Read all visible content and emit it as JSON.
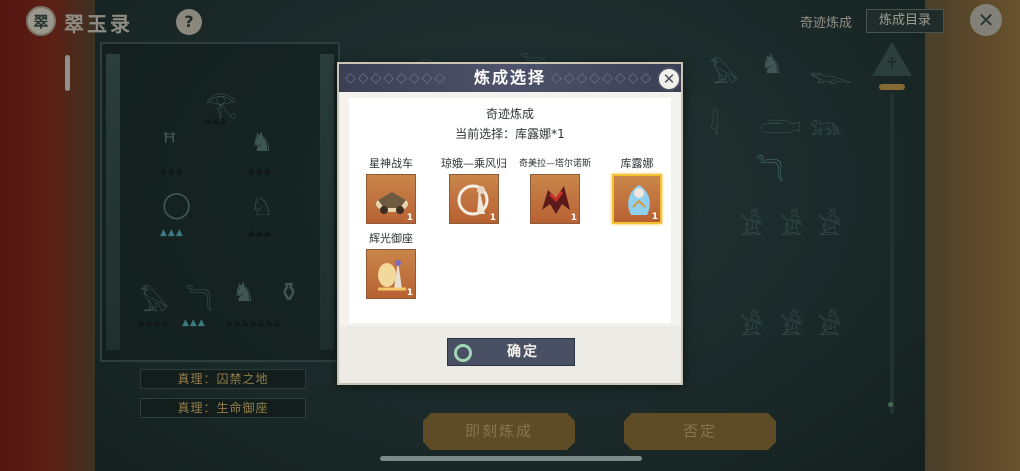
{
  "topbar": {
    "app_title": "翠玉录",
    "help_glyph": "?",
    "miracle_link": "奇迹炼成",
    "catalog_button": "炼成目录",
    "close_glyph": "✕",
    "logo_glyph": "翠"
  },
  "background": {
    "truths": [
      "真理：囚禁之地",
      "真理：生命御座"
    ],
    "ankh_glyph": "☥"
  },
  "actions": {
    "instant_label": "即刻炼成",
    "deny_label": "否定"
  },
  "modal": {
    "title": "炼成选择",
    "close_glyph": "✕",
    "subtitle": "奇迹炼成",
    "current_selection": "当前选择：库露娜*1",
    "confirm_label": "确定",
    "items": [
      {
        "name": "星神战车",
        "qty": "1",
        "icon": "chariot-icon",
        "selected": false
      },
      {
        "name": "琼娥—乘风归",
        "qty": "1",
        "icon": "moon-maiden-icon",
        "selected": false
      },
      {
        "name": "奇美拉—塔尔诺斯",
        "qty": "1",
        "icon": "chimera-icon",
        "selected": false
      },
      {
        "name": "库露娜",
        "qty": "1",
        "icon": "kuruna-icon",
        "selected": true
      },
      {
        "name": "辉光御座",
        "qty": "1",
        "icon": "radiant-throne-icon",
        "selected": false
      }
    ]
  },
  "colors": {
    "accent_gold": "#f2c233",
    "modal_header": "#4d526a",
    "action_button": "#8a6d33"
  }
}
